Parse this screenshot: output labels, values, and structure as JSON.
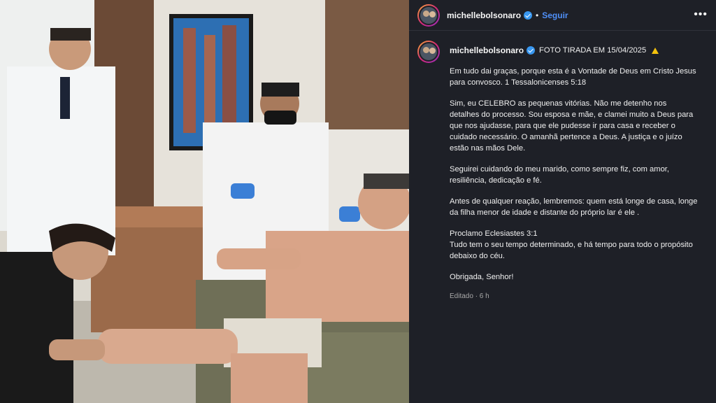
{
  "post": {
    "username": "michellebolsonaro",
    "follow_label": "Seguir",
    "more_label": "•••",
    "caption_header": "FOTO TIRADA EM 15/04/2025",
    "paragraphs": [
      "Em tudo dai graças, porque esta é a Vontade de Deus em Cristo Jesus para convosco. 1 Tessalonicenses 5:18",
      "Sim, eu CELEBRO as pequenas vitórias. Não me detenho nos detalhes do processo. Sou esposa e mãe, e clamei muito a Deus para que nos ajudasse, para que ele pudesse ir para casa e receber o cuidado necessário. O amanhã pertence a Deus. A justiça e o juízo estão nas mãos Dele.",
      "Seguirei cuidando do meu marido, como sempre fiz, com amor, resiliência, dedicação e fé.",
      "Antes de qualquer reação, lembremos: quem está longe de casa, longe da filha menor de idade e distante do próprio lar é ele .",
      "Proclamo Eclesiastes 3:1\nTudo tem o seu tempo determinado, e há tempo para todo o propósito debaixo do céu.",
      "Obrigada, Senhor!"
    ],
    "edited_label": "Editado · 6 h"
  },
  "colors": {
    "panel_bg": "#1e2027",
    "follow": "#4f8ff7",
    "verified": "#3897f0"
  }
}
